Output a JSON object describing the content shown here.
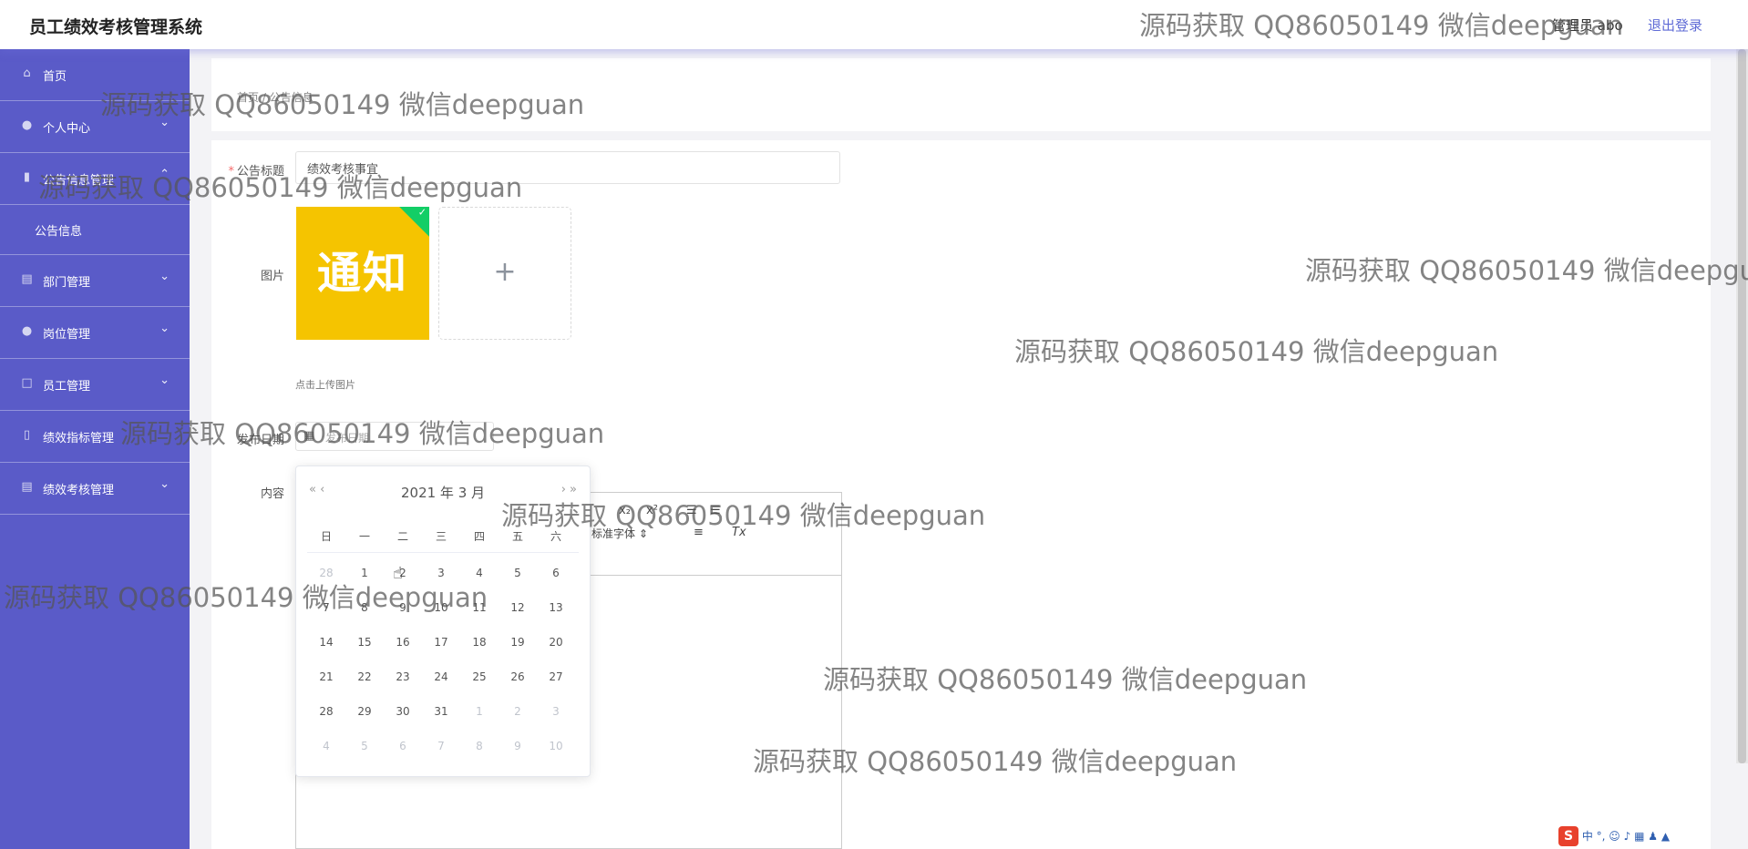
{
  "header": {
    "title": "员工绩效考核管理系统",
    "user_label": "管理员 abo",
    "logout_label": "退出登录"
  },
  "sidebar": {
    "items": [
      {
        "label": "首页",
        "icon": "home-icon"
      },
      {
        "label": "个人中心",
        "icon": "user-icon"
      },
      {
        "label": "公告信息管理",
        "icon": "notice-icon"
      },
      {
        "label": "部门管理",
        "icon": "clipboard-icon"
      },
      {
        "label": "岗位管理",
        "icon": "user-icon"
      },
      {
        "label": "员工管理",
        "icon": "square-icon"
      },
      {
        "label": "绩效指标管理",
        "icon": "mic-icon"
      },
      {
        "label": "绩效考核管理",
        "icon": "clipboard-icon"
      }
    ],
    "subitem": "公告信息"
  },
  "breadcrumb": "首页 / 公告信息",
  "form": {
    "title_label": "公告标题",
    "title_value": "绩效考核事宜",
    "image_label": "图片",
    "image_text": "通知",
    "upload_hint": "点击上传图片",
    "date_label": "发布日期",
    "date_placeholder": "发布日期",
    "content_label": "内容"
  },
  "editor": {
    "font_select": "标准字体",
    "subscript": "x₂",
    "superscript": "x²",
    "clear_format": "Tx"
  },
  "datepicker": {
    "header": "2021 年  3 月",
    "prev": "« ‹",
    "next": "› »",
    "weekdays": [
      "日",
      "一",
      "二",
      "三",
      "四",
      "五",
      "六"
    ],
    "weeks": [
      [
        "28",
        "1",
        "2",
        "3",
        "4",
        "5",
        "6"
      ],
      [
        "7",
        "8",
        "9",
        "10",
        "11",
        "12",
        "13"
      ],
      [
        "14",
        "15",
        "16",
        "17",
        "18",
        "19",
        "20"
      ],
      [
        "21",
        "22",
        "23",
        "24",
        "25",
        "26",
        "27"
      ],
      [
        "28",
        "29",
        "30",
        "31",
        "1",
        "2",
        "3"
      ],
      [
        "4",
        "5",
        "6",
        "7",
        "8",
        "9",
        "10"
      ]
    ]
  },
  "watermark_text": "源码获取 QQ86050149 微信deepguan",
  "ime": "中 °,",
  "colors": {
    "sidebar": "#5a5bc8",
    "accent": "#5f6bd6",
    "image_bg": "#f5c400",
    "success": "#13ce66"
  }
}
